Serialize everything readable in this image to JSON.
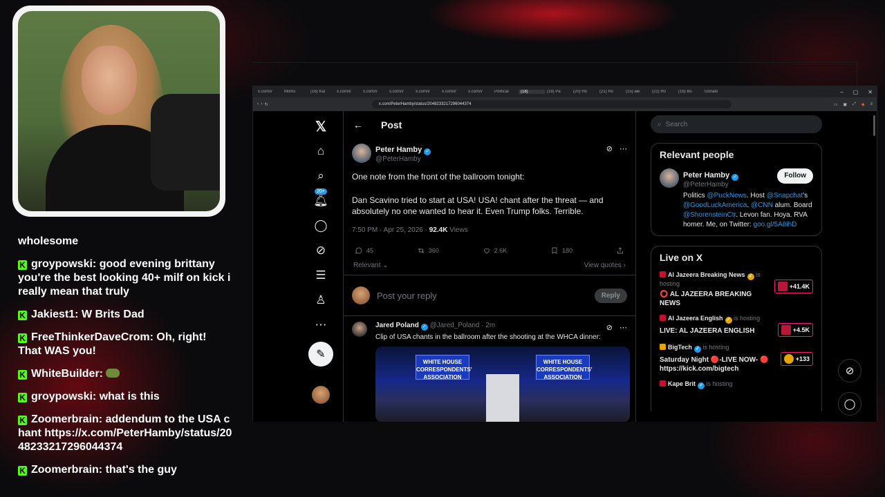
{
  "chat": {
    "messages": [
      {
        "user": "",
        "text": "wholesome"
      },
      {
        "user": "groypowski:",
        "text": "good evening brittany you're the best looking 40+ milf on kick i really mean that truly"
      },
      {
        "user": "Jakiest1:",
        "text": "W Brits Dad"
      },
      {
        "user": "FreeThinkerDaveCrom:",
        "text": "Oh, right! That WAS you!"
      },
      {
        "user": "WhiteBuilder:",
        "text": ""
      },
      {
        "user": "groypowski:",
        "text": "what is this"
      },
      {
        "user": "Zoomerbrain:",
        "text": "addendum to the USA chant https://x.com/PeterHamby/status/2048233217296044374"
      },
      {
        "user": "Zoomerbrain:",
        "text": "that's the guy"
      }
    ]
  },
  "browser": {
    "tabs": [
      "x.com/i/",
      "Moms ",
      "(16) Kai",
      "x.com/i/",
      "x.com/i/",
      "x.com/i/",
      "x.com/i/",
      "x.com/i/",
      "x.com/i/",
      "Political",
      "(18)",
      "(18) Pa",
      "(20) Ho",
      "(21) Ho",
      "(15) ale",
      "(21) Ho",
      "(16) Bo",
      "Donald"
    ],
    "url": "x.com/PeterHamby/status/2048233217296044374"
  },
  "nav": {
    "notif_badge": "20+"
  },
  "post": {
    "header": "Post",
    "author_name": "Peter Hamby",
    "author_handle": "@PeterHamby",
    "text_1": "One note from the front of the ballroom tonight:",
    "text_2": "Dan Scavino tried to start at USA! USA! chant after the threat — and absolutely no one wanted to hear it. Even Trump folks. Terrible.",
    "time": "7:50 PM · Apr 25, 2026 · ",
    "views_count": "92.4K",
    "views_label": " Views",
    "replies": "45",
    "reposts": "360",
    "likes": "2.6K",
    "bookmarks": "180",
    "sort": "Relevant",
    "view_quotes": "View quotes",
    "reply_placeholder": "Post your reply",
    "reply_button": "Reply"
  },
  "quote": {
    "author_name": "Jared Poland",
    "author_meta": "@Jared_Poland · 2m",
    "text": "Clip of USA chants in the ballroom after the shooting at the WHCA dinner:",
    "sign_text": "WHITE HOUSE CORRESPONDENTS' ASSOCIATION"
  },
  "right": {
    "search_placeholder": "Search",
    "relevant_title": "Relevant people",
    "rp_name": "Peter Hamby",
    "rp_handle": "@PeterHamby",
    "follow": "Follow",
    "bio_1": "Politics ",
    "bio_l1": "@PuckNews",
    "bio_2": ". Host ",
    "bio_l2": "@Snapchat",
    "bio_3": "'s ",
    "bio_l3": "@GoodLuckAmerica",
    "bio_4": ". ",
    "bio_l4": "@CNN",
    "bio_5": " alum. Board ",
    "bio_l5": "@ShorensteinCtr",
    "bio_6": ". Levon fan. Hoya. RVA homer. Me, on Twitter: ",
    "bio_l6": "goo.gl/5A8ihD",
    "live_title": "Live on X",
    "live": [
      {
        "host": "Al Jazeera Breaking News",
        "is": " is hosting",
        "title": "⭕ AL JAZEERA BREAKING NEWS",
        "count": "+41.4K",
        "color": "#c8102e"
      },
      {
        "host": "Al Jazeera English",
        "is": " is hosting",
        "title": "LIVE: AL JAZEERA ENGLISH",
        "count": "+4.5K",
        "color": "#c8102e"
      },
      {
        "host": "BigTech",
        "is": " is hosting",
        "title": "Saturday Night 🔴-LIVE NOW- 🔴 https://kick.com/bigtech",
        "count": "+133",
        "color": "#e5a400"
      },
      {
        "host": "Kape Brit",
        "is": " is hosting",
        "title": "",
        "count": "",
        "color": "#c8102e"
      }
    ]
  },
  "colors": {
    "accent": "#1d9bf0",
    "kick": "#53fc18",
    "live": "#f91880"
  }
}
